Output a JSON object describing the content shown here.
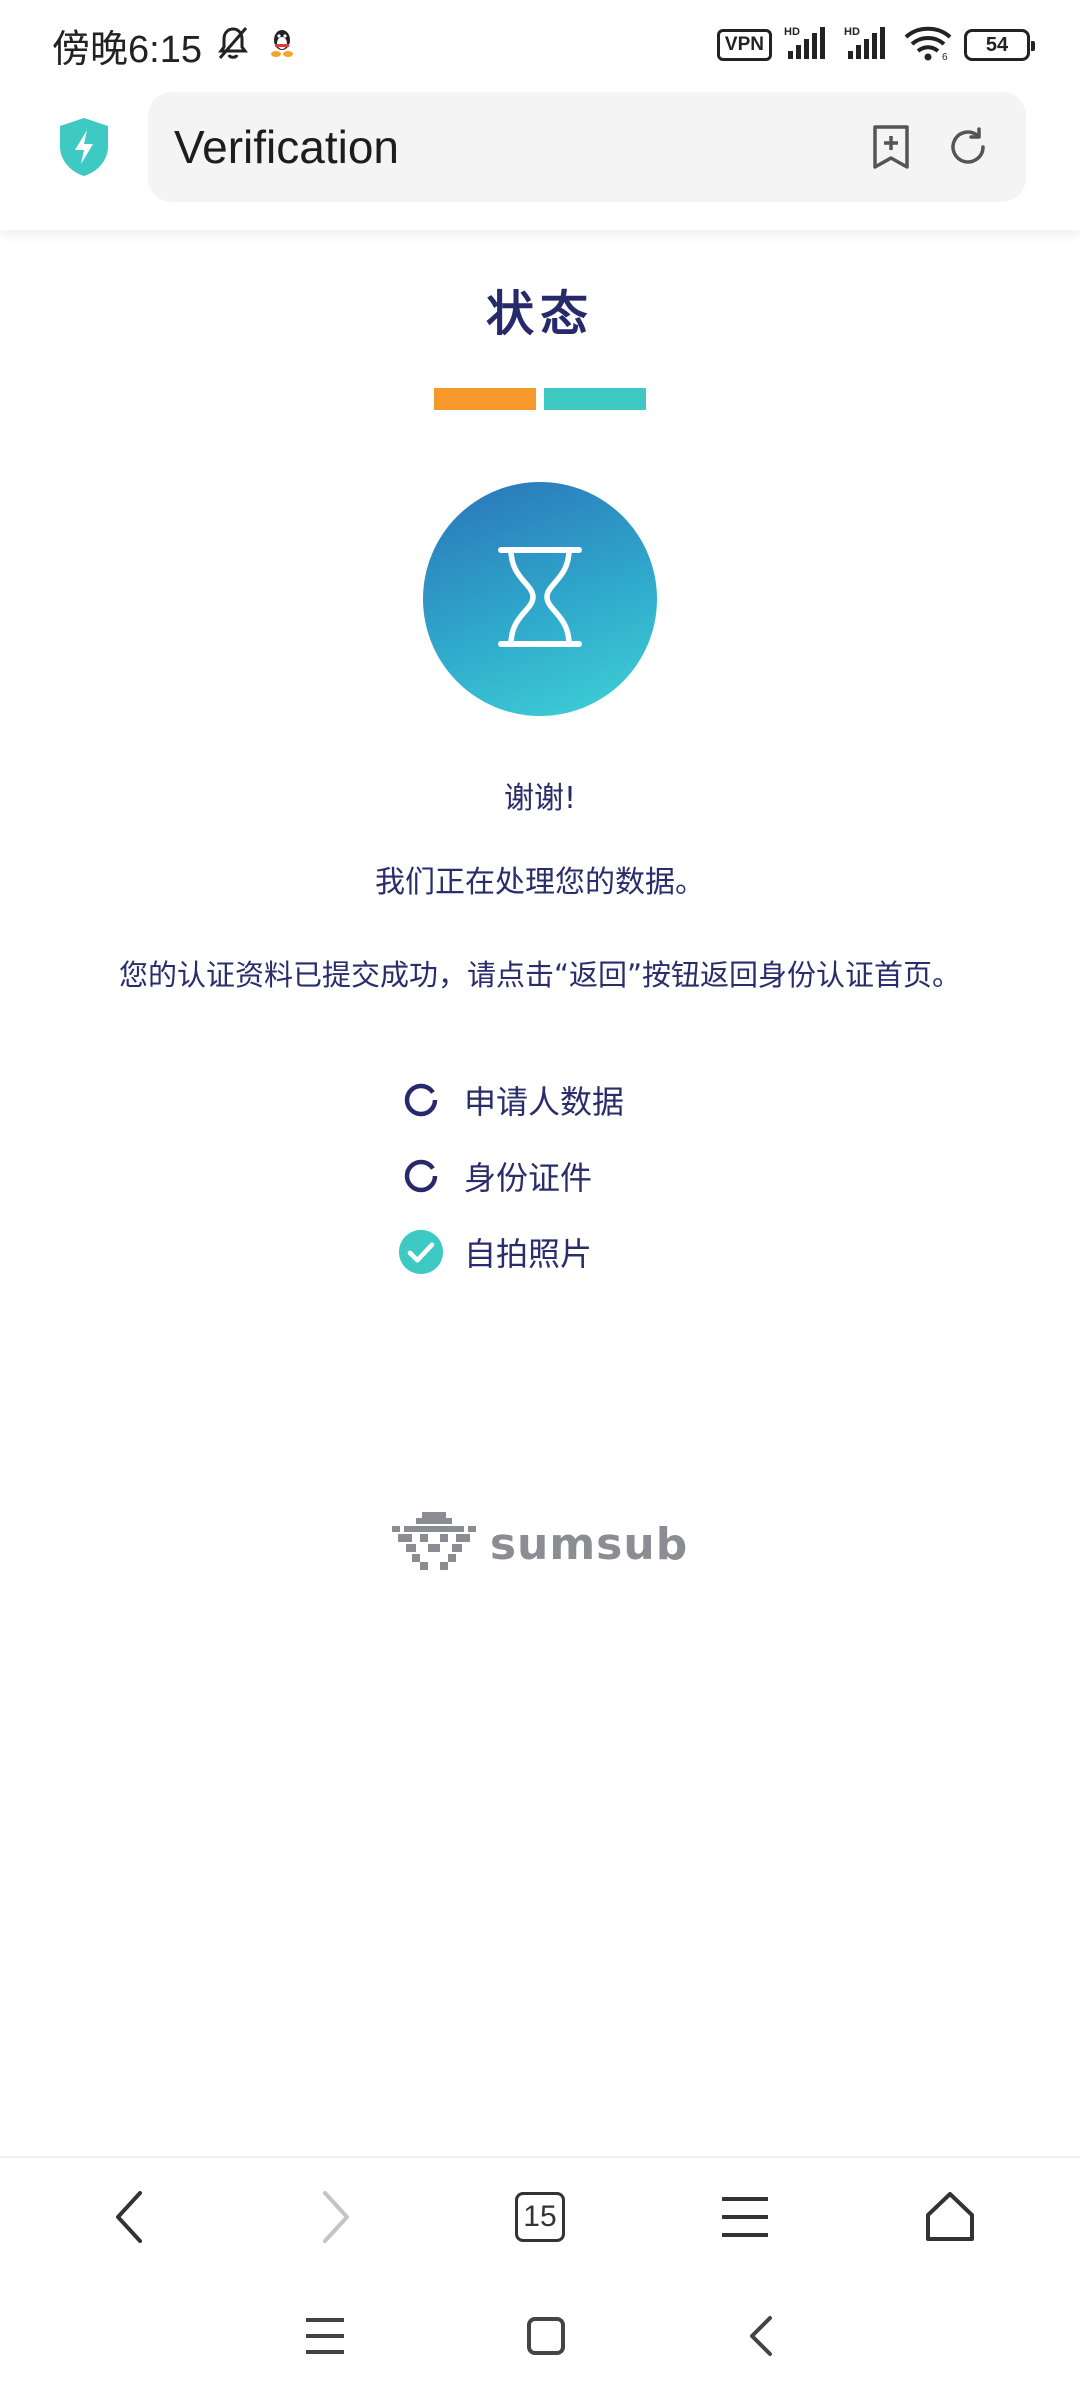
{
  "status_bar": {
    "time": "傍晚6:15",
    "vpn": "VPN",
    "battery": "54"
  },
  "browser": {
    "url_title": "Verification"
  },
  "content": {
    "title": "状态",
    "accent_colors": [
      "#f7992a",
      "#3ec9c3"
    ],
    "thanks": "谢谢!",
    "processing": "我们正在处理您的数据。",
    "info": "您的认证资料已提交成功，请点击“返回”按钮返回身份认证首页。",
    "steps": [
      {
        "label": "申请人数据",
        "status": "pending"
      },
      {
        "label": "身份证件",
        "status": "pending"
      },
      {
        "label": "自拍照片",
        "status": "done"
      }
    ],
    "brand": "sumsub"
  },
  "toolbar": {
    "tab_count": "15"
  },
  "colors": {
    "primary_text": "#2a2d6b",
    "check": "#3ec9c3",
    "shield": "#3ec9c3"
  }
}
